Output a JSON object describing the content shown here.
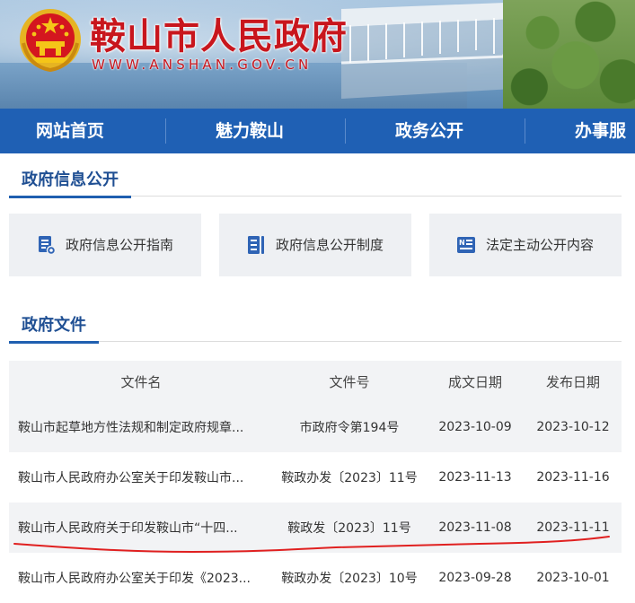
{
  "header": {
    "site_title": "鞍山市人民政府",
    "site_domain": "WWW.ANSHAN.GOV.CN",
    "brand_color": "#c8161d"
  },
  "nav": {
    "items": [
      {
        "label": "网站首页"
      },
      {
        "label": "魅力鞍山"
      },
      {
        "label": "政务公开"
      },
      {
        "label": "办事服"
      }
    ],
    "color": "#1f60b4"
  },
  "info_section": {
    "title": "政府信息公开",
    "cards": [
      {
        "label": "政府信息公开指南",
        "icon": "guide-icon"
      },
      {
        "label": "政府信息公开制度",
        "icon": "list-icon"
      },
      {
        "label": "法定主动公开内容",
        "icon": "news-icon"
      }
    ]
  },
  "docs_section": {
    "title": "政府文件",
    "columns": [
      "文件名",
      "文件号",
      "成文日期",
      "发布日期"
    ],
    "rows": [
      {
        "name": "鞍山市起草地方性法规和制定政府规章...",
        "number": "市政府令第194号",
        "written": "2023-10-09",
        "published": "2023-10-12"
      },
      {
        "name": "鞍山市人民政府办公室关于印发鞍山市...",
        "number": "鞍政办发〔2023〕11号",
        "written": "2023-11-13",
        "published": "2023-11-16"
      },
      {
        "name": "鞍山市人民政府关于印发鞍山市“十四...",
        "number": "鞍政发〔2023〕11号",
        "written": "2023-11-08",
        "published": "2023-11-11"
      },
      {
        "name": "鞍山市人民政府办公室关于印发《2023...",
        "number": "鞍政办发〔2023〕10号",
        "written": "2023-09-28",
        "published": "2023-10-01"
      }
    ],
    "highlight_color": "#e02020"
  }
}
